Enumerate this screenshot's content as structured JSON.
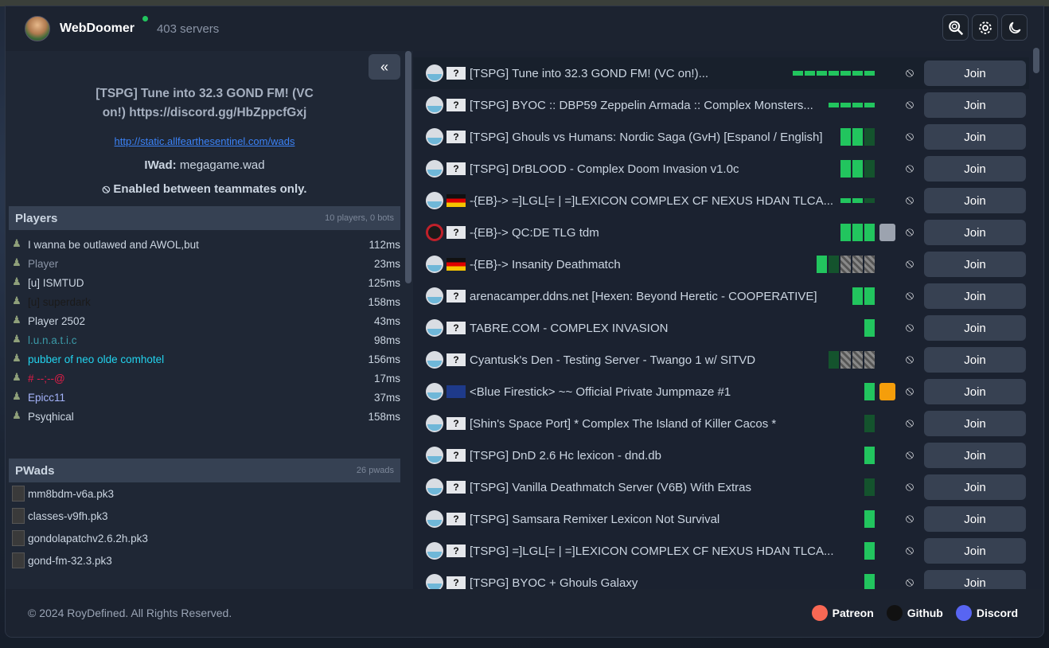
{
  "header": {
    "brand": "WebDoomer",
    "server_count": "403 servers",
    "online_color": "#22c55e",
    "buttons": {
      "search": "search-icon",
      "settings": "gear-icon",
      "theme": "moon-icon"
    }
  },
  "details": {
    "collapse_label": "«",
    "title": "[TSPG] Tune into 32.3 GOND FM! (VC on!) https://discord.gg/HbZppcfGxj",
    "link": "http://static.allfearthesentinel.com/wads",
    "iwad_label": "IWad:",
    "iwad_value": "megagame.wad",
    "friendly_fire": "Enabled between teammates only."
  },
  "players": {
    "title": "Players",
    "count": "10 players, 0 bots",
    "rows": [
      {
        "name": "I wanna be outlawed and AWOL,but",
        "ping": "112ms",
        "color": "#cbd5e1"
      },
      {
        "name": "Player",
        "ping": "23ms",
        "color": "#8a94a6"
      },
      {
        "name": "[u] ISMTUD",
        "ping": "125ms",
        "color": "#cbd5e1"
      },
      {
        "name": "[u] superdark",
        "ping": "158ms",
        "color": "#1a1a1a"
      },
      {
        "name": "Player 2502",
        "ping": "43ms",
        "color": "#cbd5e1"
      },
      {
        "name": "l.u.n.a.t.i.c",
        "ping": "98ms",
        "color": "#3b9aa8"
      },
      {
        "name": "pubber of neo olde comhotel",
        "ping": "156ms",
        "color": "#22d3ee"
      },
      {
        "name": "# --;--@",
        "ping": "17ms",
        "color": "#e11d48"
      },
      {
        "name": "Epicc11",
        "ping": "37ms",
        "color": "#a5b4fc"
      },
      {
        "name": "Psyqhical",
        "ping": "158ms",
        "color": "#cbd5e1"
      }
    ]
  },
  "pwads": {
    "title": "PWads",
    "count": "26 pwads",
    "rows": [
      "mm8bdm-v6a.pk3",
      "classes-v9fh.pk3",
      "gondolapatchv2.6.2h.pk3",
      "gond-fm-32.3.pk3"
    ]
  },
  "servers": {
    "join_label": "Join",
    "rows": [
      {
        "name": "[TSPG] Tune into 32.3 GOND FM! (VC on!)...",
        "flag": "?",
        "selected": true
      },
      {
        "name": "[TSPG] BYOC :: DBP59 Zeppelin Armada :: Complex Monsters...",
        "flag": "?"
      },
      {
        "name": "[TSPG] Ghouls vs Humans: Nordic Saga (GvH) [Espanol / English]",
        "flag": "?"
      },
      {
        "name": "[TSPG] DrBLOOD - Complex Doom Invasion v1.0c",
        "flag": "?"
      },
      {
        "name": "-{EB}-> =]LGL[= | =]LEXICON COMPLEX CF NEXUS HDAN TLCA...",
        "flag": "DE"
      },
      {
        "name": "-{EB}-> QC:DE TLG tdm",
        "flag": "?",
        "icon": "q"
      },
      {
        "name": "-{EB}-> Insanity Deathmatch",
        "flag": "DE"
      },
      {
        "name": "arenacamper.ddns.net [Hexen: Beyond Heretic - COOPERATIVE]",
        "flag": "?"
      },
      {
        "name": "TABRE.COM - COMPLEX INVASION",
        "flag": "?"
      },
      {
        "name": "Cyantusk's Den - Testing Server - Twango 1 w/ SITVD",
        "flag": "?"
      },
      {
        "name": "<Blue Firestick> ~~ Official Private Jumpmaze #1",
        "flag": "GB"
      },
      {
        "name": "[Shin's Space Port] * Complex The Island of Killer Cacos *",
        "flag": "?"
      },
      {
        "name": "[TSPG] DnD 2.6 Hc lexicon - dnd.db",
        "flag": "?"
      },
      {
        "name": "[TSPG] Vanilla Deathmatch Server (V6B) With Extras",
        "flag": "?"
      },
      {
        "name": "[TSPG] Samsara Remixer Lexicon Not Survival",
        "flag": "?"
      },
      {
        "name": "[TSPG] =]LGL[= | =]LEXICON COMPLEX CF NEXUS HDAN TLCA...",
        "flag": "?"
      },
      {
        "name": "[TSPG] BYOC + Ghouls Galaxy",
        "flag": "?"
      }
    ]
  },
  "footer": {
    "copyright": "© 2024 RoyDefined. All Rights Reserved.",
    "links": [
      {
        "label": "Patreon",
        "color": "#f96854"
      },
      {
        "label": "Github",
        "color": "#111111"
      },
      {
        "label": "Discord",
        "color": "#5865f2"
      }
    ]
  }
}
